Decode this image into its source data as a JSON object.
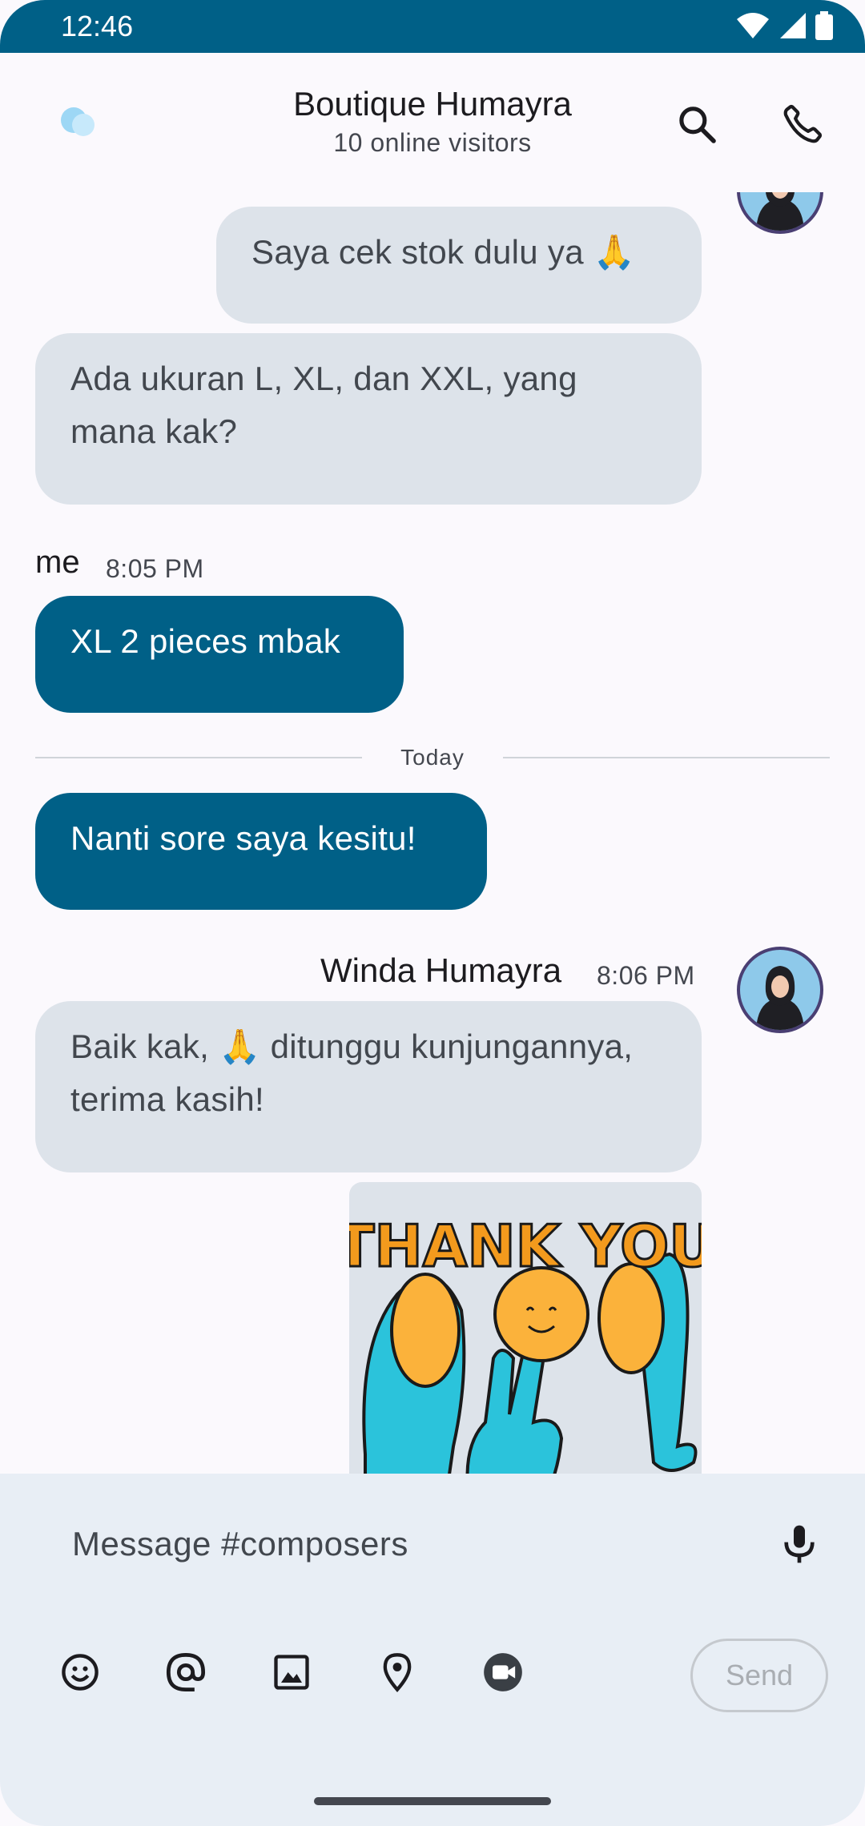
{
  "status": {
    "time": "12:46"
  },
  "header": {
    "title": "Boutique Humayra",
    "subtitle": "10 online visitors"
  },
  "messages": {
    "m1": "Saya cek stok dulu ya 🙏",
    "m2": "Ada ukuran L, XL, dan XXL, yang mana kak?",
    "me_author": "me",
    "me_time": "8:05 PM",
    "m3": "XL 2 pieces mbak",
    "divider": "Today",
    "m4": "Nanti sore saya kesitu!",
    "winda_author": "Winda Humayra",
    "winda_time": "8:06 PM",
    "m5": "Baik kak, 🙏 ditunggu kunjungannya, terima kasih!",
    "sticker_text": "THANK YOU"
  },
  "composer": {
    "placeholder": "Message #composers",
    "send_label": "Send"
  },
  "icons": {
    "header": [
      "search-icon",
      "phone-icon"
    ],
    "tools": [
      "emoji-icon",
      "mention-icon",
      "image-icon",
      "location-icon",
      "video-icon"
    ]
  },
  "colors": {
    "primary": "#006087",
    "other_bubble": "#dde3ea",
    "composer_bg": "#e8eef5"
  }
}
